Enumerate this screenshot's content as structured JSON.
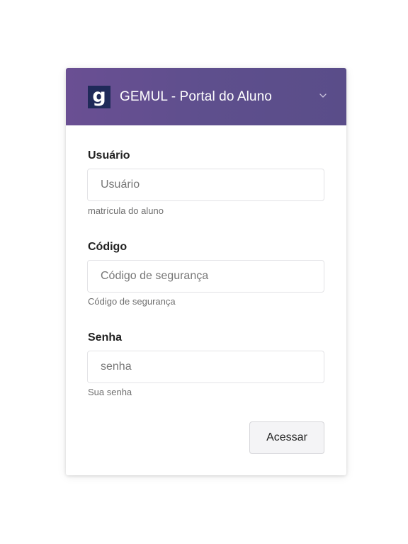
{
  "header": {
    "logo_letter": "g",
    "title": "GEMUL - Portal do Aluno"
  },
  "form": {
    "fields": [
      {
        "label": "Usuário",
        "placeholder": "Usuário",
        "help": "matrícula do aluno"
      },
      {
        "label": "Código",
        "placeholder": "Código de segurança",
        "help": "Código de segurança"
      },
      {
        "label": "Senha",
        "placeholder": "senha",
        "help": "Sua senha"
      }
    ],
    "submit_label": "Acessar"
  },
  "icons": {
    "logo": "letter-g-logo",
    "expand": "chevron-down-icon"
  },
  "colors": {
    "header_background": "#5e4f8d",
    "logo_background": "#1f2a59"
  }
}
